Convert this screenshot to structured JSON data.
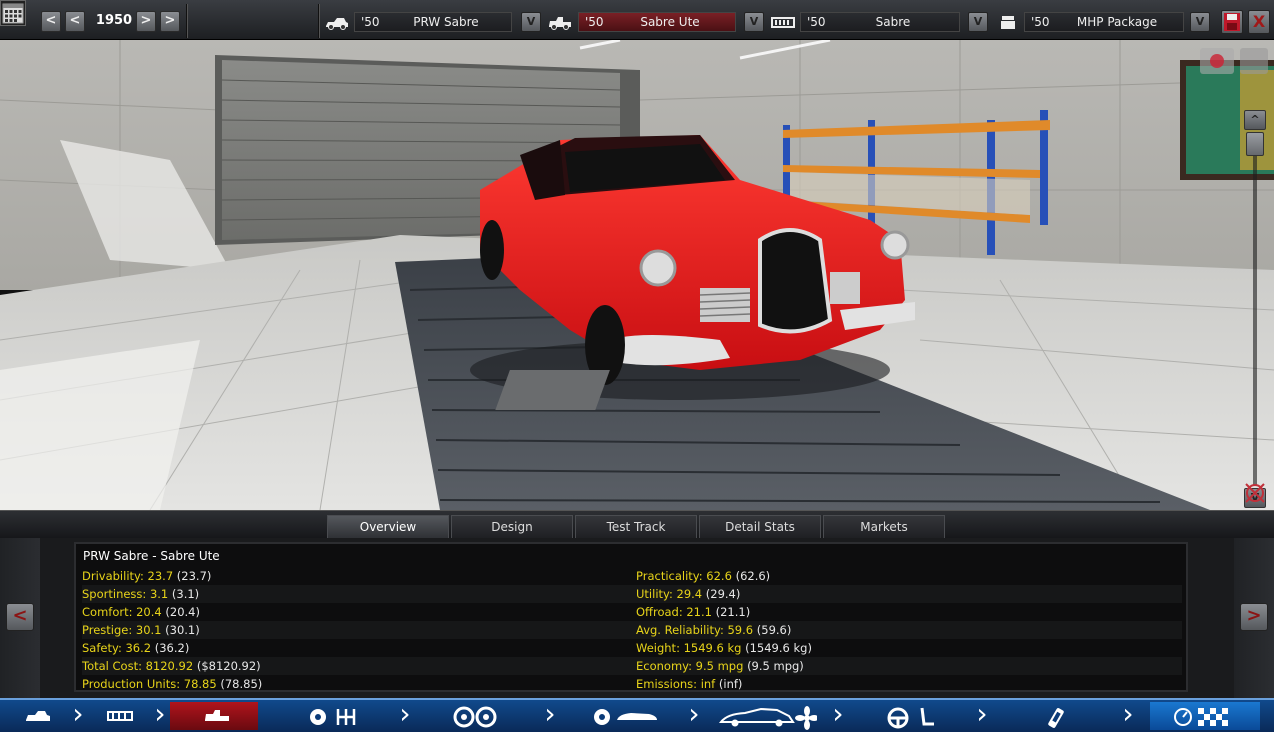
{
  "topbar": {
    "year": "1950",
    "prev_label": "<",
    "next_label": ">",
    "selectors": [
      {
        "year": "'50",
        "name": "PRW Sabre",
        "icon": "car-family-icon",
        "v": "V"
      },
      {
        "year": "'50",
        "name": "Sabre Ute",
        "icon": "car-model-icon",
        "v": "V"
      },
      {
        "year": "'50",
        "name": "Sabre",
        "icon": "trim-icon",
        "v": "V"
      },
      {
        "year": "'50",
        "name": "MHP Package",
        "icon": "engine-icon",
        "v": "V"
      }
    ],
    "close_label": "X"
  },
  "viewport": {
    "scroll_up": "^",
    "scroll_down": "V",
    "car_color": "#e8191c"
  },
  "tabs": [
    "Overview",
    "Design",
    "Test Track",
    "Detail Stats",
    "Markets"
  ],
  "active_tab": "Overview",
  "overview": {
    "title": "PRW Sabre - Sabre Ute",
    "left": [
      {
        "label": "Drivability: 23.7",
        "paren": "(23.7)"
      },
      {
        "label": "Sportiness: 3.1",
        "paren": "(3.1)"
      },
      {
        "label": "Comfort: 20.4",
        "paren": "(20.4)"
      },
      {
        "label": "Prestige: 30.1",
        "paren": "(30.1)"
      },
      {
        "label": "Safety: 36.2",
        "paren": "(36.2)"
      },
      {
        "label": "Total Cost: 8120.92",
        "paren": "($8120.92)"
      },
      {
        "label": "Production Units: 78.85",
        "paren": "(78.85)"
      }
    ],
    "right": [
      {
        "label": "Practicality: 62.6",
        "paren": "(62.6)"
      },
      {
        "label": "Utility: 29.4",
        "paren": "(29.4)"
      },
      {
        "label": "Offroad: 21.1",
        "paren": "(21.1)"
      },
      {
        "label": "Avg. Reliability: 59.6",
        "paren": "(59.6)"
      },
      {
        "label": "Weight: 1549.6 kg",
        "paren": "(1549.6 kg)"
      },
      {
        "label": "Economy: 9.5 mpg",
        "paren": "(9.5 mpg)"
      },
      {
        "label": "Emissions: inf",
        "paren": "(inf)"
      }
    ],
    "prev_label": "<",
    "next_label": ">"
  },
  "steps": [
    {
      "icon": "car-family-icon",
      "active": false
    },
    {
      "icon": "chassis-icon",
      "active": false
    },
    {
      "icon": "model-icon",
      "active": true
    },
    {
      "icon": "engine-gearbox-icon",
      "active": false
    },
    {
      "icon": "wheels-icon",
      "active": false
    },
    {
      "icon": "suspension-body-icon",
      "active": false
    },
    {
      "icon": "body-cooling-icon",
      "active": false
    },
    {
      "icon": "interior-icon",
      "active": false
    },
    {
      "icon": "fuel-icon",
      "active": false
    },
    {
      "icon": "finish-icon",
      "active": false
    }
  ]
}
